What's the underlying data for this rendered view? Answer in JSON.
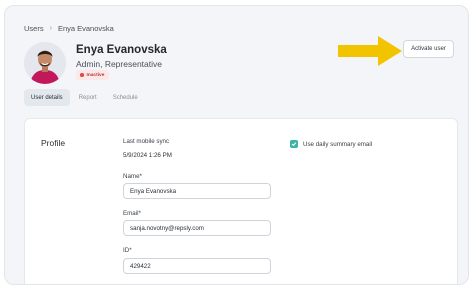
{
  "breadcrumb": {
    "root": "Users",
    "current": "Enya Evanovska"
  },
  "profile_header": {
    "name": "Enya Evanovska",
    "role": "Admin, Representative",
    "status": "Inactive"
  },
  "actions": {
    "activate_label": "Activate user"
  },
  "tabs": [
    {
      "label": "User details",
      "active": true
    },
    {
      "label": "Report",
      "active": false
    },
    {
      "label": "Schedule",
      "active": false
    }
  ],
  "card": {
    "section_title": "Profile",
    "last_sync_label": "Last mobile sync",
    "last_sync_value": "5/9/2024 1:26 PM",
    "name_label": "Name*",
    "name_value": "Enya Evanovska",
    "email_label": "Email*",
    "email_value": "sanja.novotny@repsly.com",
    "id_label": "ID*",
    "id_value": "429422",
    "daily_summary_label": "Use daily summary email",
    "daily_summary_checked": true
  },
  "colors": {
    "accent": "#3bb3a5",
    "arrow": "#f2c400",
    "status_inactive": "#e0484b"
  }
}
